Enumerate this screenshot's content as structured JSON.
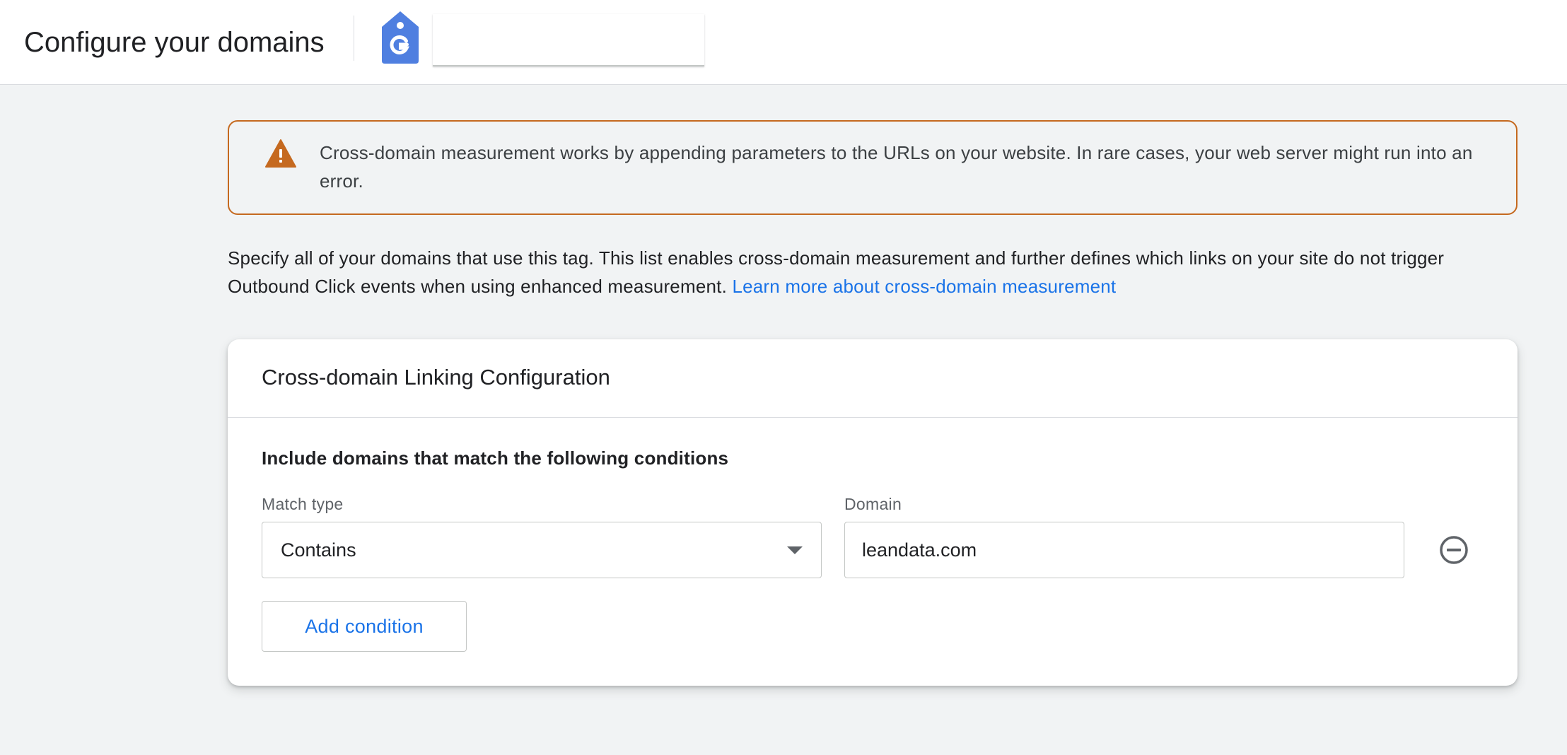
{
  "header": {
    "title": "Configure your domains",
    "tag_icon": "google-tag-icon",
    "tag_input_value": ""
  },
  "warning": {
    "icon": "warning-triangle-icon",
    "text": "Cross-domain measurement works by appending parameters to the URLs on your website. In rare cases, your web server might run into an error."
  },
  "description": {
    "text": "Specify all of your domains that use this tag. This list enables cross-domain measurement and further defines which links on your site do not trigger Outbound Click events when using enhanced measurement.",
    "link_text": "Learn more about cross-domain measurement"
  },
  "card": {
    "title": "Cross-domain Linking Configuration",
    "conditions_heading": "Include domains that match the following conditions",
    "match_type_label": "Match type",
    "match_type_value": "Contains",
    "domain_label": "Domain",
    "domain_value": "leandata.com",
    "remove_icon": "remove-circle-icon",
    "add_condition_label": "Add condition"
  },
  "colors": {
    "accent": "#1a73e8",
    "warning_border": "#c5691f",
    "warning_icon": "#c5691f",
    "page_background": "#f1f3f4"
  }
}
